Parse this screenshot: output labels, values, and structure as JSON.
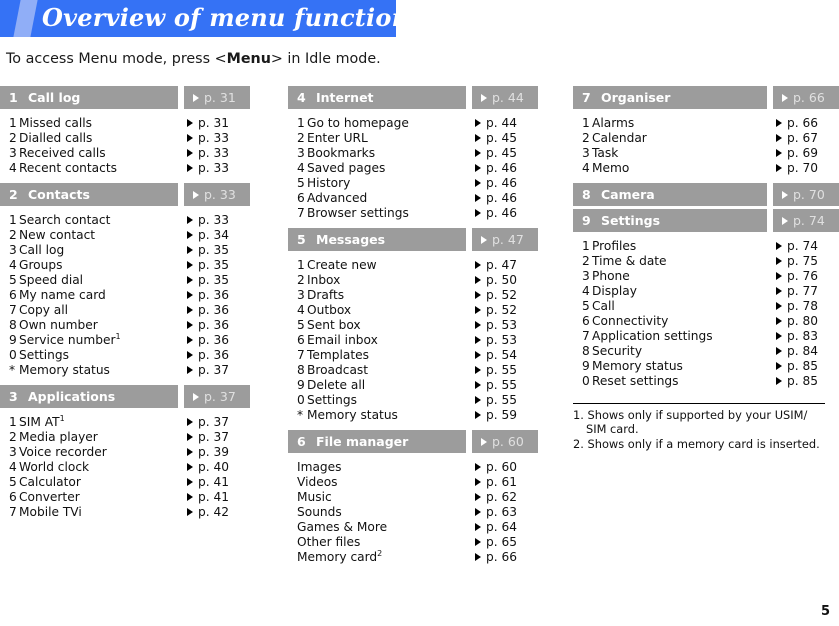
{
  "header": {
    "title": "Overview of menu functions",
    "banner_color": "#3572f5",
    "accent_color": "#90aef7"
  },
  "intro": {
    "before": "To access Menu mode, press <",
    "bold": "Menu",
    "after": "> in Idle mode."
  },
  "colors": {
    "section_bar": "#9c9c9c",
    "section_title_text": "#ffffff",
    "section_page_text": "#e0e0e0",
    "body_text": "#111111"
  },
  "columns": [
    {
      "sections": [
        {
          "num": "1",
          "title": "Call log",
          "page": "p. 31",
          "numbered": true,
          "items": [
            {
              "num": "1",
              "label": "Missed calls",
              "page": "p. 31"
            },
            {
              "num": "2",
              "label": "Dialled calls",
              "page": "p. 33"
            },
            {
              "num": "3",
              "label": "Received calls",
              "page": "p. 33"
            },
            {
              "num": "4",
              "label": "Recent contacts",
              "page": "p. 33"
            }
          ]
        },
        {
          "num": "2",
          "title": "Contacts",
          "page": "p. 33",
          "numbered": true,
          "items": [
            {
              "num": "1",
              "label": "Search contact",
              "page": "p. 33"
            },
            {
              "num": "2",
              "label": "New contact",
              "page": "p. 34"
            },
            {
              "num": "3",
              "label": "Call log",
              "page": "p. 35"
            },
            {
              "num": "4",
              "label": "Groups",
              "page": "p. 35"
            },
            {
              "num": "5",
              "label": "Speed dial",
              "page": "p. 35"
            },
            {
              "num": "6",
              "label": "My name card",
              "page": "p. 36"
            },
            {
              "num": "7",
              "label": "Copy all",
              "page": "p. 36"
            },
            {
              "num": "8",
              "label": "Own number",
              "page": "p. 36"
            },
            {
              "num": "9",
              "label": "Service number",
              "footnote": "1",
              "page": "p. 36"
            },
            {
              "num": "0",
              "label": "Settings",
              "page": "p. 36"
            },
            {
              "num": "*",
              "label": "Memory status",
              "page": "p. 37"
            }
          ]
        },
        {
          "num": "3",
          "title": "Applications",
          "page": "p. 37",
          "numbered": true,
          "items": [
            {
              "num": "1",
              "label": "SIM AT",
              "footnote": "1",
              "page": "p. 37"
            },
            {
              "num": "2",
              "label": "Media player",
              "page": "p. 37"
            },
            {
              "num": "3",
              "label": "Voice recorder",
              "page": "p. 39"
            },
            {
              "num": "4",
              "label": "World clock",
              "page": "p. 40"
            },
            {
              "num": "5",
              "label": "Calculator",
              "page": "p. 41"
            },
            {
              "num": "6",
              "label": "Converter",
              "page": "p. 41"
            },
            {
              "num": "7",
              "label": "Mobile TVi",
              "page": "p. 42"
            }
          ]
        }
      ]
    },
    {
      "sections": [
        {
          "num": "4",
          "title": "Internet",
          "page": "p. 44",
          "numbered": true,
          "items": [
            {
              "num": "1",
              "label": "Go to homepage",
              "page": "p. 44"
            },
            {
              "num": "2",
              "label": "Enter URL",
              "page": "p. 45"
            },
            {
              "num": "3",
              "label": "Bookmarks",
              "page": "p. 45"
            },
            {
              "num": "4",
              "label": "Saved pages",
              "page": "p. 46"
            },
            {
              "num": "5",
              "label": "History",
              "page": "p. 46"
            },
            {
              "num": "6",
              "label": "Advanced",
              "page": "p. 46"
            },
            {
              "num": "7",
              "label": "Browser settings",
              "page": "p. 46"
            }
          ]
        },
        {
          "num": "5",
          "title": "Messages",
          "page": "p. 47",
          "numbered": true,
          "items": [
            {
              "num": "1",
              "label": "Create new",
              "page": "p. 47"
            },
            {
              "num": "2",
              "label": "Inbox",
              "page": "p. 50"
            },
            {
              "num": "3",
              "label": "Drafts",
              "page": "p. 52"
            },
            {
              "num": "4",
              "label": "Outbox",
              "page": "p. 52"
            },
            {
              "num": "5",
              "label": "Sent box",
              "page": "p. 53"
            },
            {
              "num": "6",
              "label": "Email inbox",
              "page": "p. 53"
            },
            {
              "num": "7",
              "label": "Templates",
              "page": "p. 54"
            },
            {
              "num": "8",
              "label": "Broadcast",
              "page": "p. 55"
            },
            {
              "num": "9",
              "label": "Delete all",
              "page": "p. 55"
            },
            {
              "num": "0",
              "label": "Settings",
              "page": "p. 55"
            },
            {
              "num": "*",
              "label": "Memory status",
              "page": "p. 59"
            }
          ]
        },
        {
          "num": "6",
          "title": "File manager",
          "page": "p. 60",
          "numbered": false,
          "items": [
            {
              "num": "",
              "label": "Images",
              "page": "p. 60"
            },
            {
              "num": "",
              "label": "Videos",
              "page": "p. 61"
            },
            {
              "num": "",
              "label": "Music",
              "page": "p. 62"
            },
            {
              "num": "",
              "label": "Sounds",
              "page": "p. 63"
            },
            {
              "num": "",
              "label": "Games & More",
              "page": "p. 64"
            },
            {
              "num": "",
              "label": "Other files",
              "page": "p. 65"
            },
            {
              "num": "",
              "label": "Memory card",
              "footnote": "2",
              "page": "p. 66"
            }
          ]
        }
      ]
    },
    {
      "sections": [
        {
          "num": "7",
          "title": "Organiser",
          "page": "p. 66",
          "numbered": true,
          "items": [
            {
              "num": "1",
              "label": "Alarms",
              "page": "p. 66"
            },
            {
              "num": "2",
              "label": "Calendar",
              "page": "p. 67"
            },
            {
              "num": "3",
              "label": "Task",
              "page": "p. 69"
            },
            {
              "num": "4",
              "label": "Memo",
              "page": "p. 70"
            }
          ]
        },
        {
          "num": "8",
          "title": "Camera",
          "page": "p. 70",
          "numbered": true,
          "items": []
        },
        {
          "num": "9",
          "title": "Settings",
          "page": "p. 74",
          "numbered": true,
          "items": [
            {
              "num": "1",
              "label": "Profiles",
              "page": "p. 74"
            },
            {
              "num": "2",
              "label": "Time & date",
              "page": "p. 75"
            },
            {
              "num": "3",
              "label": "Phone",
              "page": "p. 76"
            },
            {
              "num": "4",
              "label": "Display",
              "page": "p. 77"
            },
            {
              "num": "5",
              "label": "Call",
              "page": "p. 78"
            },
            {
              "num": "6",
              "label": "Connectivity",
              "page": "p. 80"
            },
            {
              "num": "7",
              "label": "Application settings",
              "page": "p. 83"
            },
            {
              "num": "8",
              "label": "Security",
              "page": "p. 84"
            },
            {
              "num": "9",
              "label": "Memory status",
              "page": "p. 85"
            },
            {
              "num": "0",
              "label": "Reset settings",
              "page": "p. 85"
            }
          ]
        }
      ]
    }
  ],
  "footnotes": [
    "1. Shows only if supported by your USIM/ SIM card.",
    "2. Shows only if a memory card is inserted."
  ],
  "page_number": "5"
}
